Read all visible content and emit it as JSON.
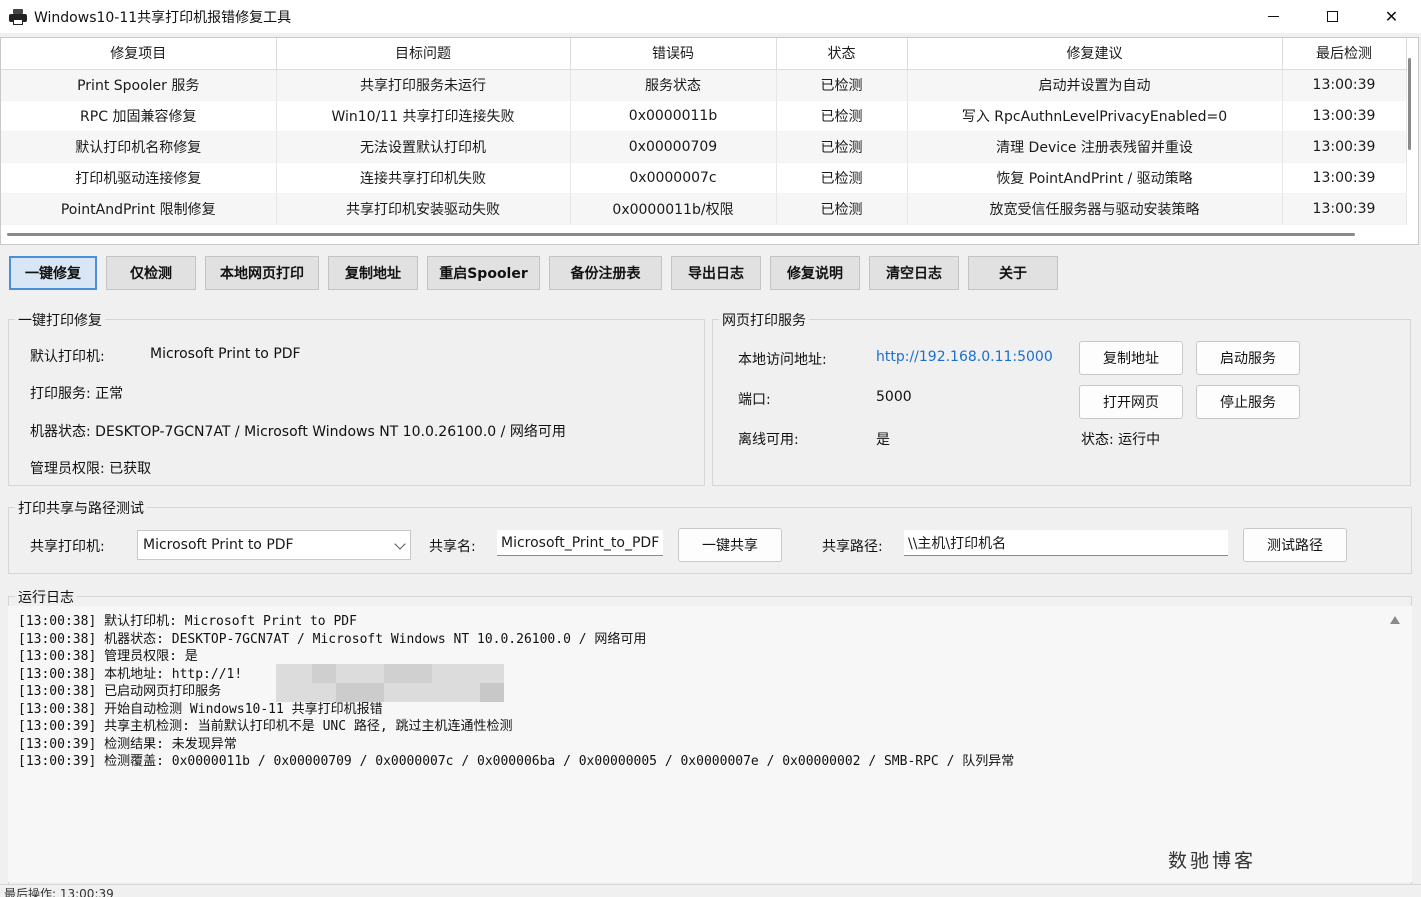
{
  "window": {
    "title": "Windows10-11共享打印机报错修复工具",
    "app_icon": "printer-icon"
  },
  "table": {
    "columns": [
      "修复项目",
      "目标问题",
      "错误码",
      "状态",
      "修复建议",
      "最后检测"
    ],
    "rows": [
      [
        "Print Spooler 服务",
        "共享打印服务未运行",
        "服务状态",
        "已检测",
        "启动并设置为自动",
        "13:00:39"
      ],
      [
        "RPC 加固兼容修复",
        "Win10/11 共享打印连接失败",
        "0x0000011b",
        "已检测",
        "写入 RpcAuthnLevelPrivacyEnabled=0",
        "13:00:39"
      ],
      [
        "默认打印机名称修复",
        "无法设置默认打印机",
        "0x00000709",
        "已检测",
        "清理 Device 注册表残留并重设",
        "13:00:39"
      ],
      [
        "打印机驱动连接修复",
        "连接共享打印机失败",
        "0x0000007c",
        "已检测",
        "恢复 PointAndPrint / 驱动策略",
        "13:00:39"
      ],
      [
        "PointAndPrint 限制修复",
        "共享打印机安装驱动失败",
        "0x0000011b/权限",
        "已检测",
        "放宽受信任服务器与驱动安装策略",
        "13:00:39"
      ]
    ]
  },
  "toolbar": {
    "buttons": [
      "一键修复",
      "仅检测",
      "本地网页打印",
      "复制地址",
      "重启Spooler",
      "备份注册表",
      "导出日志",
      "修复说明",
      "清空日志",
      "关于"
    ]
  },
  "repair_group": {
    "title": "一键打印修复",
    "default_printer_label": "默认打印机:",
    "default_printer_value": "Microsoft Print to PDF",
    "spooler_status": "打印服务: 正常",
    "machine_status": "机器状态: DESKTOP-7GCN7AT / Microsoft Windows NT 10.0.26100.0 / 网络可用",
    "admin_status": "管理员权限: 已获取"
  },
  "web_group": {
    "title": "网页打印服务",
    "url_label": "本地访问地址:",
    "url_value": "http://192.168.0.11:5000",
    "port_label": "端口:",
    "port_value": "5000",
    "offline_label": "离线可用:",
    "offline_value": "是",
    "copy_btn": "复制地址",
    "start_btn": "启动服务",
    "open_btn": "打开网页",
    "stop_btn": "停止服务",
    "status": "状态: 运行中"
  },
  "share_group": {
    "title": "打印共享与路径测试",
    "printer_label": "共享打印机:",
    "printer_value": "Microsoft Print to PDF",
    "share_name_label": "共享名:",
    "share_name_value": "Microsoft_Print_to_PDF",
    "share_btn": "一键共享",
    "path_label": "共享路径:",
    "path_value": "\\\\主机\\打印机名",
    "test_btn": "测试路径"
  },
  "log": {
    "title": "运行日志",
    "lines": [
      "[13:00:38] 默认打印机: Microsoft Print to PDF",
      "[13:00:38] 机器状态: DESKTOP-7GCN7AT / Microsoft Windows NT 10.0.26100.0 / 网络可用",
      "[13:00:38] 管理员权限: 是",
      "[13:00:38] 本机地址: http://1!",
      "[13:00:38] 已启动网页打印服务",
      "[13:00:38] 开始自动检测 Windows10-11 共享打印机报错",
      "[13:00:39] 共享主机检测: 当前默认打印机不是 UNC 路径, 跳过主机连通性检测",
      "[13:00:39] 检测结果: 未发现异常",
      "[13:00:39] 检测覆盖: 0x0000011b / 0x00000709 / 0x0000007c / 0x000006ba / 0x00000005 / 0x0000007e / 0x00000002 / SMB-RPC / 队列异常"
    ]
  },
  "watermark": "数驰博客",
  "statusbar": "最后操作: 13:00:39"
}
